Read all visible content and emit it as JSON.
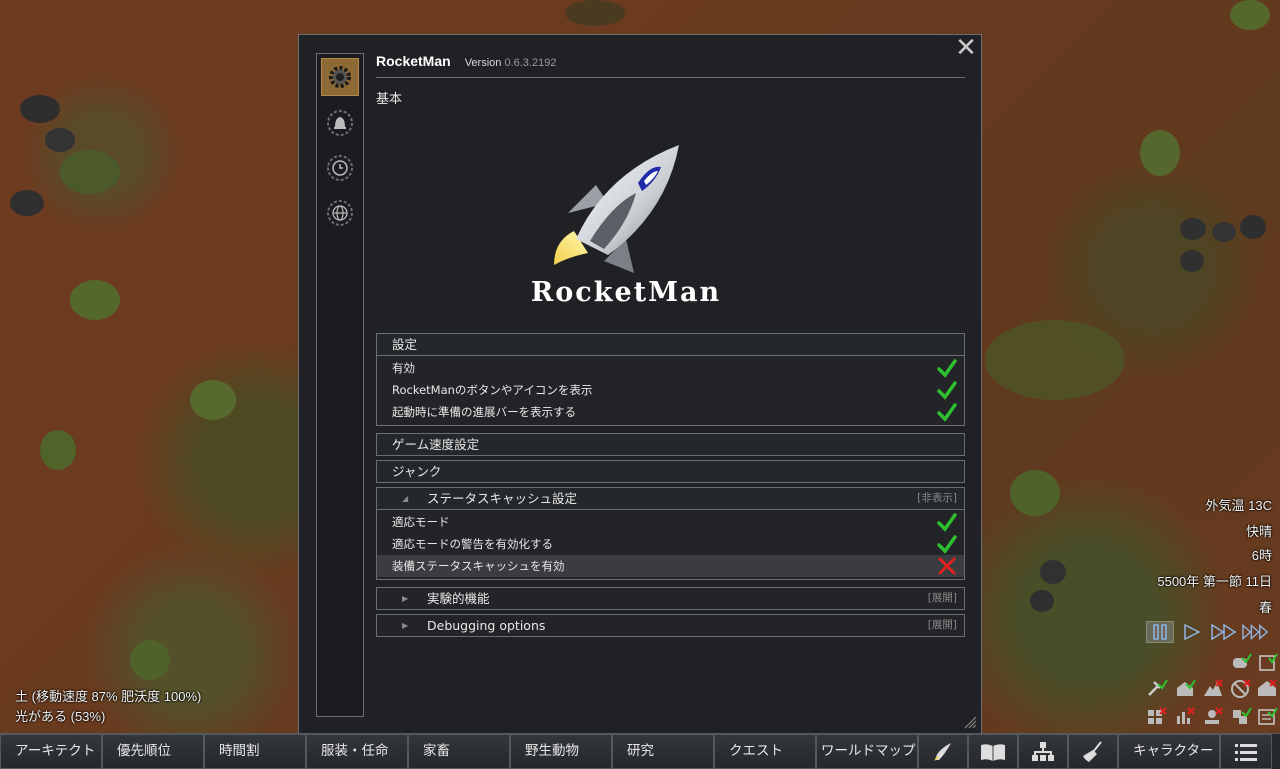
{
  "dialog": {
    "title": "RocketMan",
    "version_label": "Version",
    "version_number": "0.6.3.2192",
    "section": "基本",
    "logo_text": "RocketMan",
    "side_tabs": [
      "gear-icon",
      "bell-icon",
      "clock-icon",
      "globe-icon"
    ],
    "settings": {
      "header": "設定",
      "rows": [
        {
          "label": "有効",
          "state": "on"
        },
        {
          "label": "RocketManのボタンやアイコンを表示",
          "state": "on"
        },
        {
          "label": "起動時に準備の進展バーを表示する",
          "state": "on"
        }
      ]
    },
    "game_speed": "ゲーム速度設定",
    "junk": "ジャンク",
    "stat_cache": {
      "header": "ステータスキャッシュ設定",
      "state": "[非表示]",
      "rows": [
        {
          "label": "適応モード",
          "state": "on"
        },
        {
          "label": "適応モードの警告を有効化する",
          "state": "on"
        },
        {
          "label": "装備ステータスキャッシュを有効",
          "state": "off"
        }
      ]
    },
    "experimental": {
      "header": "実験的機能",
      "state": "[展開]"
    },
    "debugging": {
      "header": "Debugging options",
      "state": "[展開]"
    }
  },
  "hud": {
    "temp": "外気温 13C",
    "weather": "快晴",
    "hour": "6時",
    "date": "5500年 第一節 11日",
    "season": "春"
  },
  "cell_info": {
    "terrain": "土 (移動速度 87% 肥沃度 100%)",
    "light": "光がある (53%)"
  },
  "bottom_bar": {
    "architect": "アーキテクト",
    "priority": "優先順位",
    "schedule": "時間割",
    "assign": "服装・任命",
    "animals": "家畜",
    "wildlife": "野生動物",
    "research": "研究",
    "quests": "クエスト",
    "world": "ワールドマップ",
    "character": "キャラクター"
  },
  "colors": {
    "check_on": "#2ec02e",
    "check_off": "#e02020",
    "tab_active": "#8d6a35"
  }
}
